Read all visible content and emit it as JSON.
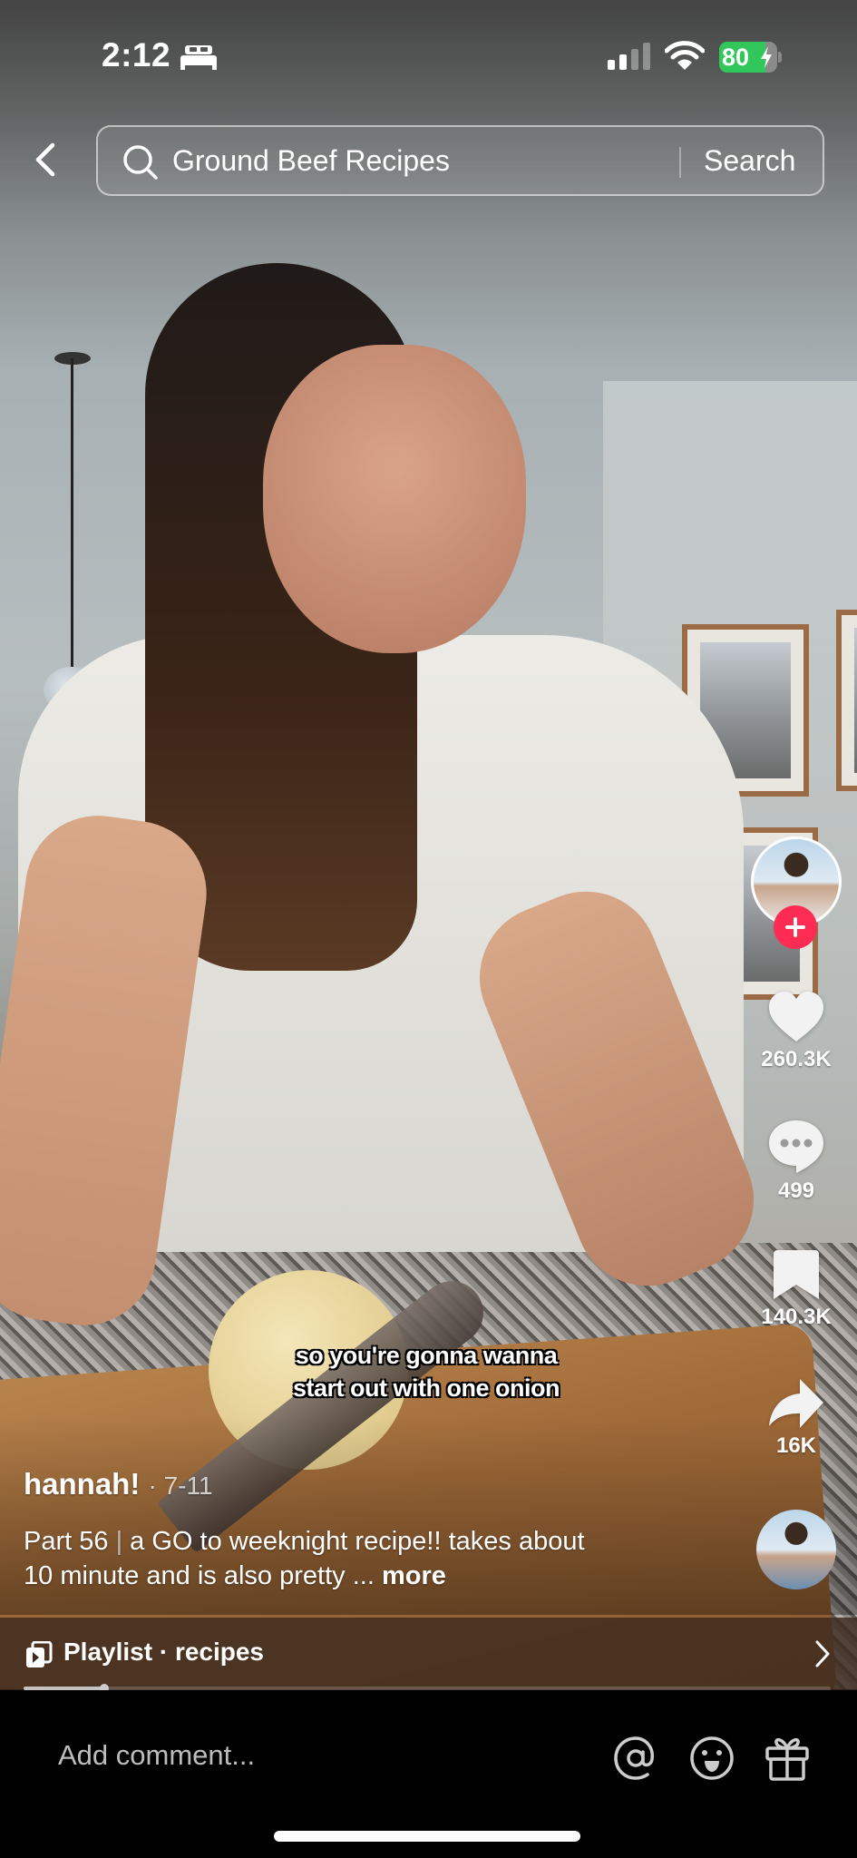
{
  "status_bar": {
    "time": "2:12",
    "focus_icon": "bed-icon",
    "battery_percent": 80,
    "battery_text": "80",
    "charging": true,
    "signal_bars_active": 2,
    "signal_bars_total": 4
  },
  "header": {
    "back_icon": "chevron-left-icon",
    "search_query": "Ground Beef Recipes",
    "search_button_label": "Search"
  },
  "rail": {
    "like_count": "260.3K",
    "comment_count": "499",
    "save_count": "140.3K",
    "share_count": "16K",
    "follow_color": "#fe2c55"
  },
  "video": {
    "subtitle_line1": "so you're gonna wanna",
    "subtitle_line2": "start out with one onion",
    "author": "hannah!",
    "date": "· 7-11",
    "description_part": "Part 56",
    "description_sep": "|",
    "description_text": "a GO to weeknight recipe!! takes about 10 minute and is also pretty ...",
    "more_label": "more",
    "progress_fraction": 0.1
  },
  "playlist": {
    "label": "Playlist · recipes"
  },
  "comment_bar": {
    "placeholder": "Add comment..."
  }
}
